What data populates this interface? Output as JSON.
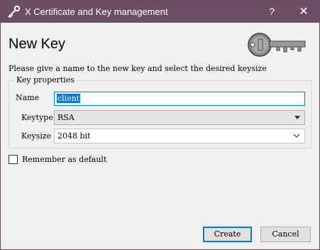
{
  "window": {
    "title": "X Certificate and Key management",
    "help_label": "?",
    "close_label": "✕"
  },
  "heading": "New Key",
  "instruction": "Please give a name to the new key and select the desired keysize",
  "key_properties": {
    "group_title": "Key properties",
    "name_label": "Name",
    "name_value": "client",
    "keytype_label": "Keytype",
    "keytype_value": "RSA",
    "keysize_label": "Keysize",
    "keysize_value": "2048 bit"
  },
  "remember": {
    "label": "Remember as default",
    "checked": false
  },
  "buttons": {
    "create": "Create",
    "cancel": "Cancel"
  },
  "colors": {
    "titlebar": "#6c4d63",
    "focus": "#0078d7"
  },
  "icons": {
    "app": "key-icon",
    "header_image": "key-image"
  }
}
